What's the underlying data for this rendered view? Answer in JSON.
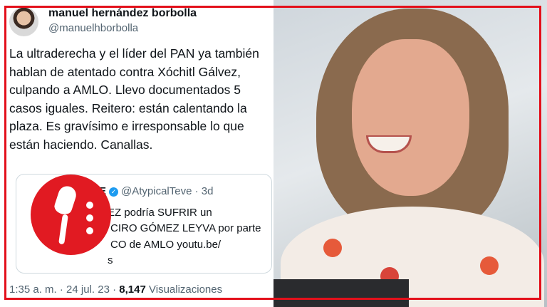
{
  "tweet": {
    "author_name": "manuel hernández borbolla",
    "author_handle": "@manuelhborbolla",
    "text": "La ultraderecha y el líder del PAN ya también hablan de atentado contra Xóchitl Gálvez, culpando a AMLO. Llevo documentados 5 casos iguales. Reitero: están calentando la plaza. Es gravísimo e irresponsable lo que están haciendo. Canallas.",
    "quote": {
      "author_name_visible": "VE",
      "author_handle": "@AtypicalTeve",
      "time": "3d",
      "lines": [
        "EZ podría SUFRIR un",
        "CIRO GÓMEZ LEYVA por parte",
        "CO de AMLO youtu.be/",
        "s"
      ]
    },
    "meta": {
      "time": "1:35 a. m.",
      "date": "24 jul. 23",
      "views": "8,147",
      "views_label": "Visualizaciones",
      "separator": "·"
    }
  },
  "colors": {
    "frame": "#e3101b",
    "badge": "#e11a22",
    "verified": "#1d9bf0",
    "secondary_text": "#536471"
  },
  "icons": [
    "microphone-icon",
    "verified-badge-icon"
  ]
}
